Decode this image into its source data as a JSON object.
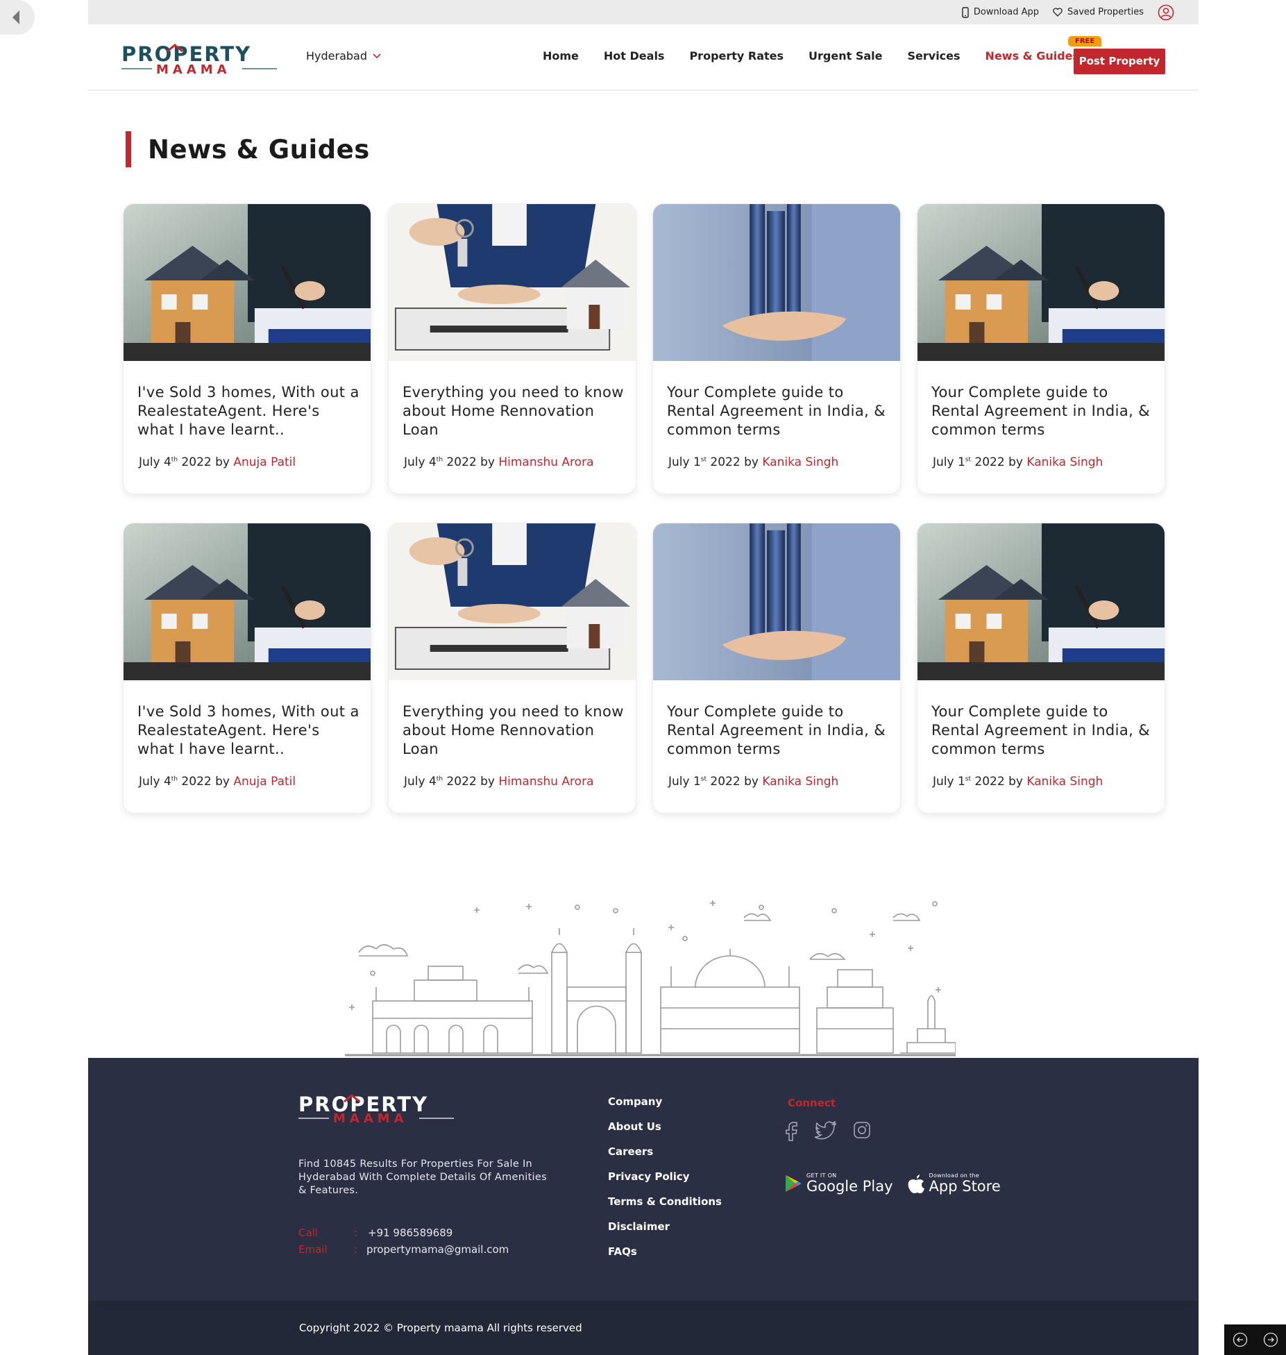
{
  "topbar": {
    "download_app": "Download App",
    "saved_properties": "Saved Properties"
  },
  "header": {
    "logo_top": "PROPERTY",
    "logo_bottom": "MAAMA",
    "city": "Hyderabad",
    "nav": [
      "Home",
      "Hot Deals",
      "Property Rates",
      "Urgent Sale",
      "Services",
      "News & Guides"
    ],
    "active_nav": "News & Guides",
    "post_badge": "FREE",
    "post_button": "Post Property"
  },
  "page_title": "News & Guides",
  "articles": [
    {
      "title": "I've Sold 3 homes, With out a RealestateAgent. Here's what I have learnt..",
      "date_prefix": "July 4",
      "date_sup": "th",
      "date_suffix": " 2022 by ",
      "author": "Anuja Patil",
      "image": "house-model-signing"
    },
    {
      "title": "Everything you need to know about Home Rennovation Loan",
      "date_prefix": "July 4",
      "date_sup": "th",
      "date_suffix": " 2022 by ",
      "author": "Himanshu Arora",
      "image": "keys-handover"
    },
    {
      "title": "Your Complete guide to Rental Agreement in India, & common terms",
      "date_prefix": "July 1",
      "date_sup": "st",
      "date_suffix": " 2022 by ",
      "author": "Kanika Singh",
      "image": "hand-holding-skyscraper"
    },
    {
      "title": "Your Complete guide to Rental Agreement in India, & common terms",
      "date_prefix": "July 1",
      "date_sup": "st",
      "date_suffix": " 2022 by ",
      "author": "Kanika Singh",
      "image": "house-model-signing"
    },
    {
      "title": "I've Sold 3 homes, With out a RealestateAgent. Here's what I have learnt..",
      "date_prefix": "July 4",
      "date_sup": "th",
      "date_suffix": " 2022 by ",
      "author": "Anuja Patil",
      "image": "house-model-signing"
    },
    {
      "title": "Everything you need to know about Home Rennovation Loan",
      "date_prefix": "July 4",
      "date_sup": "th",
      "date_suffix": " 2022 by ",
      "author": "Himanshu Arora",
      "image": "keys-handover"
    },
    {
      "title": "Your Complete guide to Rental Agreement in India, & common terms",
      "date_prefix": "July 1",
      "date_sup": "st",
      "date_suffix": " 2022 by ",
      "author": "Kanika Singh",
      "image": "hand-holding-skyscraper"
    },
    {
      "title": "Your Complete guide to Rental Agreement in India, & common terms",
      "date_prefix": "July 1",
      "date_sup": "st",
      "date_suffix": " 2022 by ",
      "author": "Kanika Singh",
      "image": "house-model-signing"
    }
  ],
  "footer": {
    "description": "Find 10845 Results For Properties For Sale In Hyderabad With Complete Details Of Amenities & Features.",
    "call_label": "Call",
    "call_value": "+91 986589689",
    "email_label": "Email",
    "email_value": "propertymama@gmail.com",
    "separator": ":",
    "links": [
      "Company",
      "About Us",
      "Careers",
      "Privacy Policy",
      "Terms & Conditions",
      "Disclaimer",
      "FAQs"
    ],
    "connect": "Connect",
    "google_small": "GET IT ON",
    "google_big": "Google Play",
    "apple_small": "Download on the",
    "apple_big": "App Store",
    "copyright": "Copyright 2022 © Property maama All rights reserved"
  },
  "colors": {
    "brand_red": "#c1272d",
    "brand_teal": "#1d4f5c",
    "footer_bg": "#2a2f44"
  }
}
